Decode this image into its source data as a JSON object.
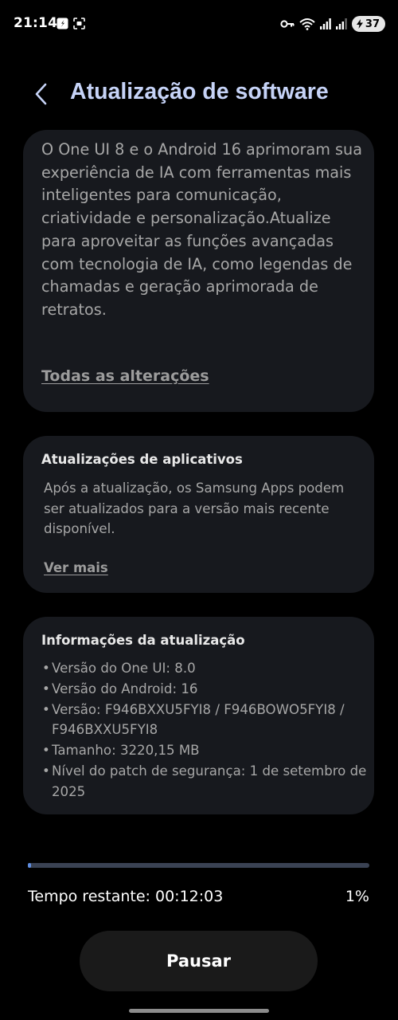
{
  "status_bar": {
    "time": "21:14",
    "battery": "37",
    "icons": [
      "music-note-icon",
      "screen-capture-icon",
      "key-icon",
      "wifi-icon",
      "signal-icon",
      "signal-icon",
      "battery-icon"
    ]
  },
  "header": {
    "title": "Atualização de software",
    "back_icon": "chevron-left-icon"
  },
  "release_notes": {
    "description": "O One UI 8 e o Android 16 aprimoram sua experiência de IA com ferramentas mais inteligentes para comunicação, criatividade e personalização.Atualize para aproveitar as funções avançadas com tecnologia de IA, como legendas de chamadas e geração aprimorada de retratos.",
    "link": "Todas as alterações"
  },
  "app_updates": {
    "title": "Atualizações de aplicativos",
    "body": "Após a atualização, os Samsung Apps podem ser atualizados para a versão mais recente disponível.",
    "link": "Ver mais"
  },
  "update_info": {
    "title": "Informações da atualização",
    "items": [
      "Versão do One UI: 8.0",
      "Versão do Android: 16",
      "Versão: F946BXXU5FYI8 / F946BOWO5FYI8 / F946BXXU5FYI8",
      "Tamanho: 3220,15 MB",
      "Nível do patch de segurança: 1 de setembro de 2025"
    ]
  },
  "progress": {
    "percent": 1,
    "percent_label": "1%",
    "time_remaining": "Tempo restante: 00:12:03"
  },
  "pause_button": "Pausar",
  "colors": {
    "accent": "#c6d3f7",
    "card_bg": "#17191e",
    "progress_fill": "#5f8de0",
    "progress_track": "#3a4253"
  }
}
